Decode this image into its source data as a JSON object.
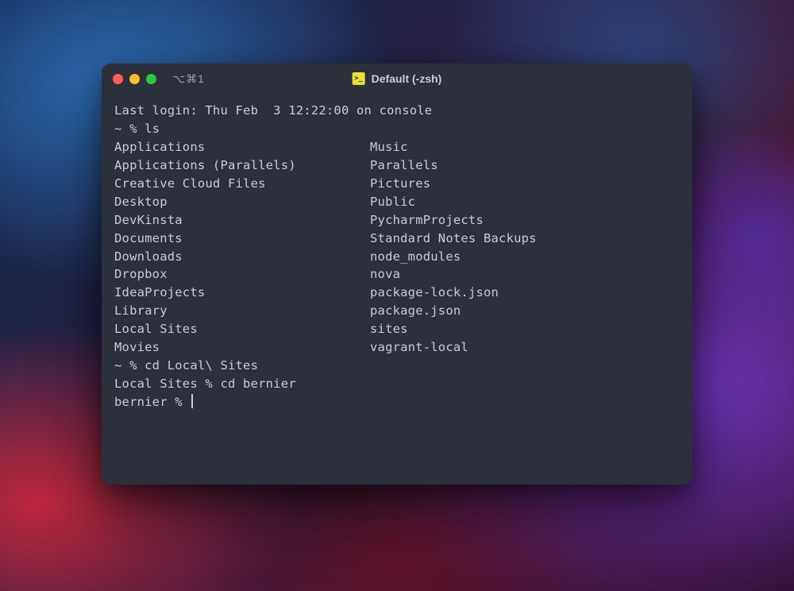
{
  "titlebar": {
    "shortcut": "⌥⌘1",
    "title": "Default (-zsh)"
  },
  "terminal": {
    "last_login": "Last login: Thu Feb  3 12:22:00 on console",
    "prompt1": "~ % ls",
    "ls_col1": [
      "Applications",
      "Applications (Parallels)",
      "Creative Cloud Files",
      "Desktop",
      "DevKinsta",
      "Documents",
      "Downloads",
      "Dropbox",
      "IdeaProjects",
      "Library",
      "Local Sites",
      "Movies"
    ],
    "ls_col2": [
      "Music",
      "Parallels",
      "Pictures",
      "Public",
      "PycharmProjects",
      "Standard Notes Backups",
      "node_modules",
      "nova",
      "package-lock.json",
      "package.json",
      "sites",
      "vagrant-local"
    ],
    "prompt2": "~ % cd Local\\ Sites",
    "prompt3": "Local Sites % cd bernier",
    "prompt4": "bernier % "
  }
}
